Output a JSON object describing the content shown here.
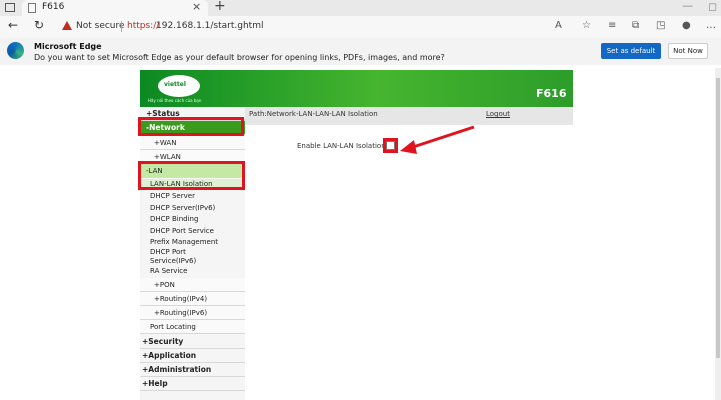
{
  "tab": {
    "title": "F616"
  },
  "address": {
    "security_label": "Not secure",
    "url_scheme": "https://",
    "url_rest": "192.168.1.1/start.ghtml"
  },
  "infobar": {
    "title": "Microsoft Edge",
    "message": "Do you want to set Microsoft Edge as your default browser for opening links, PDFs, images, and more?",
    "set_default_label": "Set as default",
    "not_now_label": "Not Now"
  },
  "header": {
    "model": "F616",
    "logo_text": "viettel",
    "slogan": "Hãy nói theo cách của bạn"
  },
  "menu": {
    "status": "+Status",
    "network": "-Network",
    "wan": "+WAN",
    "wlan": "+WLAN",
    "lan": "-LAN",
    "lan_items": [
      "LAN-LAN Isolation",
      "DHCP Server",
      "DHCP Server(IPv6)",
      "DHCP Binding",
      "DHCP Port Service",
      "Prefix Management",
      "DHCP Port Service(IPv6)",
      "RA Service"
    ],
    "pon": "+PON",
    "routing4": "+Routing(IPv4)",
    "routing6": "+Routing(IPv6)",
    "port_locating": "Port Locating",
    "security": "+Security",
    "application": "+Application",
    "administration": "+Administration",
    "help": "+Help"
  },
  "content": {
    "path": "Path:Network-LAN-LAN-LAN Isolation",
    "logout": "Logout",
    "isolation_label": "Enable LAN-LAN Isolation",
    "isolation_enabled": false
  },
  "colors": {
    "highlight": "#e0141e",
    "brand_green": "#3b9b1c"
  }
}
